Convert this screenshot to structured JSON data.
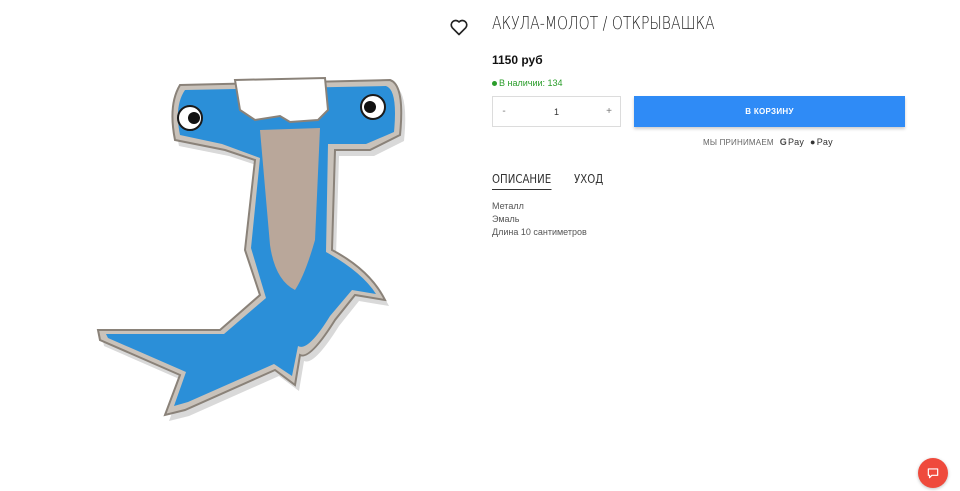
{
  "product": {
    "title": "АКУЛА-МОЛОТ / ОТКРЫВАШКА",
    "price": "1150 руб",
    "stock": "В наличии: 134",
    "image_icon": "hammerhead-shark-opener-image"
  },
  "quantity": {
    "minus": "-",
    "value": "1",
    "plus": "+"
  },
  "cart": {
    "label": "В КОРЗИНУ"
  },
  "payments": {
    "label": "МЫ ПРИНИМАЕМ",
    "google_pay": "Pay",
    "apple_pay": "Pay"
  },
  "tabs": [
    {
      "label": "ОПИСАНИЕ",
      "active": true
    },
    {
      "label": "УХОД",
      "active": false
    }
  ],
  "description": [
    "Металл",
    "Эмаль",
    "Длина 10 сантиметров"
  ],
  "colors": {
    "accent": "#2f8bf6",
    "stock": "#2a9d2a",
    "chat": "#ef4a3c",
    "shark": "#2b8fd8"
  },
  "icons": {
    "wishlist": "heart-icon",
    "chat": "chat-icon"
  }
}
